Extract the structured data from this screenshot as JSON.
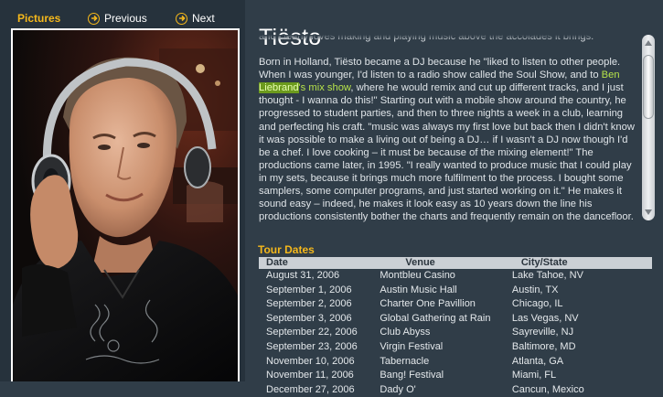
{
  "pictures": {
    "title": "Pictures",
    "prev_label": "Previous",
    "next_label": "Next"
  },
  "artist": {
    "name": "Tiësto"
  },
  "bio": {
    "p1": "and clearly loves making and playing music above the accolades it brings.",
    "p2_a": "Born in Holland, Tiësto became a DJ because he \"liked to listen to other people. When I was younger, I'd listen to a radio show called the Soul Show, and to ",
    "p2_link_a": "Ben ",
    "p2_link_word": "Liebrand",
    "p2_link_b": "'s mix show",
    "p2_b": ", where he would remix and cut up different tracks, and I just thought - I wanna do this!\" Starting out with a mobile show around the country, he progressed to student parties, and then to three nights a week in a club, learning and perfecting his craft. \"music was always my first love but back then I didn't know it was possible to make a living out of being a DJ… if I wasn't a DJ now though I'd be a chef. I love cooking – it must be because of the mixing element!\" The productions came later, in 1995. \"I really wanted to produce music that I could play in my sets, because it brings much more fulfilment to the process. I bought some samplers, some computer programs, and just started working on it.\" He makes it sound easy – indeed, he makes it look easy as 10 years down the line his productions consistently bother the charts and frequently",
    "p2_c": "remain on the dancefloor."
  },
  "tour": {
    "title": "Tour Dates",
    "headers": {
      "date": "Date",
      "venue": "Venue",
      "city": "City/State"
    },
    "rows": [
      {
        "date": "August 31, 2006",
        "venue": "Montbleu Casino",
        "city": "Lake Tahoe, NV"
      },
      {
        "date": "September 1, 2006",
        "venue": "Austin Music Hall",
        "city": "Austin, TX"
      },
      {
        "date": "September 2, 2006",
        "venue": "Charter One Pavillion",
        "city": "Chicago, IL"
      },
      {
        "date": "September 3, 2006",
        "venue": "Global Gathering at Rain",
        "city": "Las Vegas, NV"
      },
      {
        "date": "September 22, 2006",
        "venue": "Club Abyss",
        "city": "Sayreville, NJ"
      },
      {
        "date": "September 23, 2006",
        "venue": "Virgin Festival",
        "city": "Baltimore, MD"
      },
      {
        "date": "November 10, 2006",
        "venue": "Tabernacle",
        "city": "Atlanta, GA"
      },
      {
        "date": "November 11, 2006",
        "venue": "Bang! Festival",
        "city": "Miami, FL"
      },
      {
        "date": "December 27, 2006",
        "venue": "Dady O'",
        "city": "Cancun, Mexico"
      }
    ]
  },
  "colors": {
    "background": "#303d48",
    "accent": "#f5b81b",
    "link": "#b6e24a",
    "highlight": "#6c9a1d"
  },
  "icons": {
    "prev": "arrow-circle-icon",
    "next": "arrow-circle-icon",
    "scroll_up": "triangle-up-icon",
    "scroll_down": "triangle-down-icon"
  }
}
